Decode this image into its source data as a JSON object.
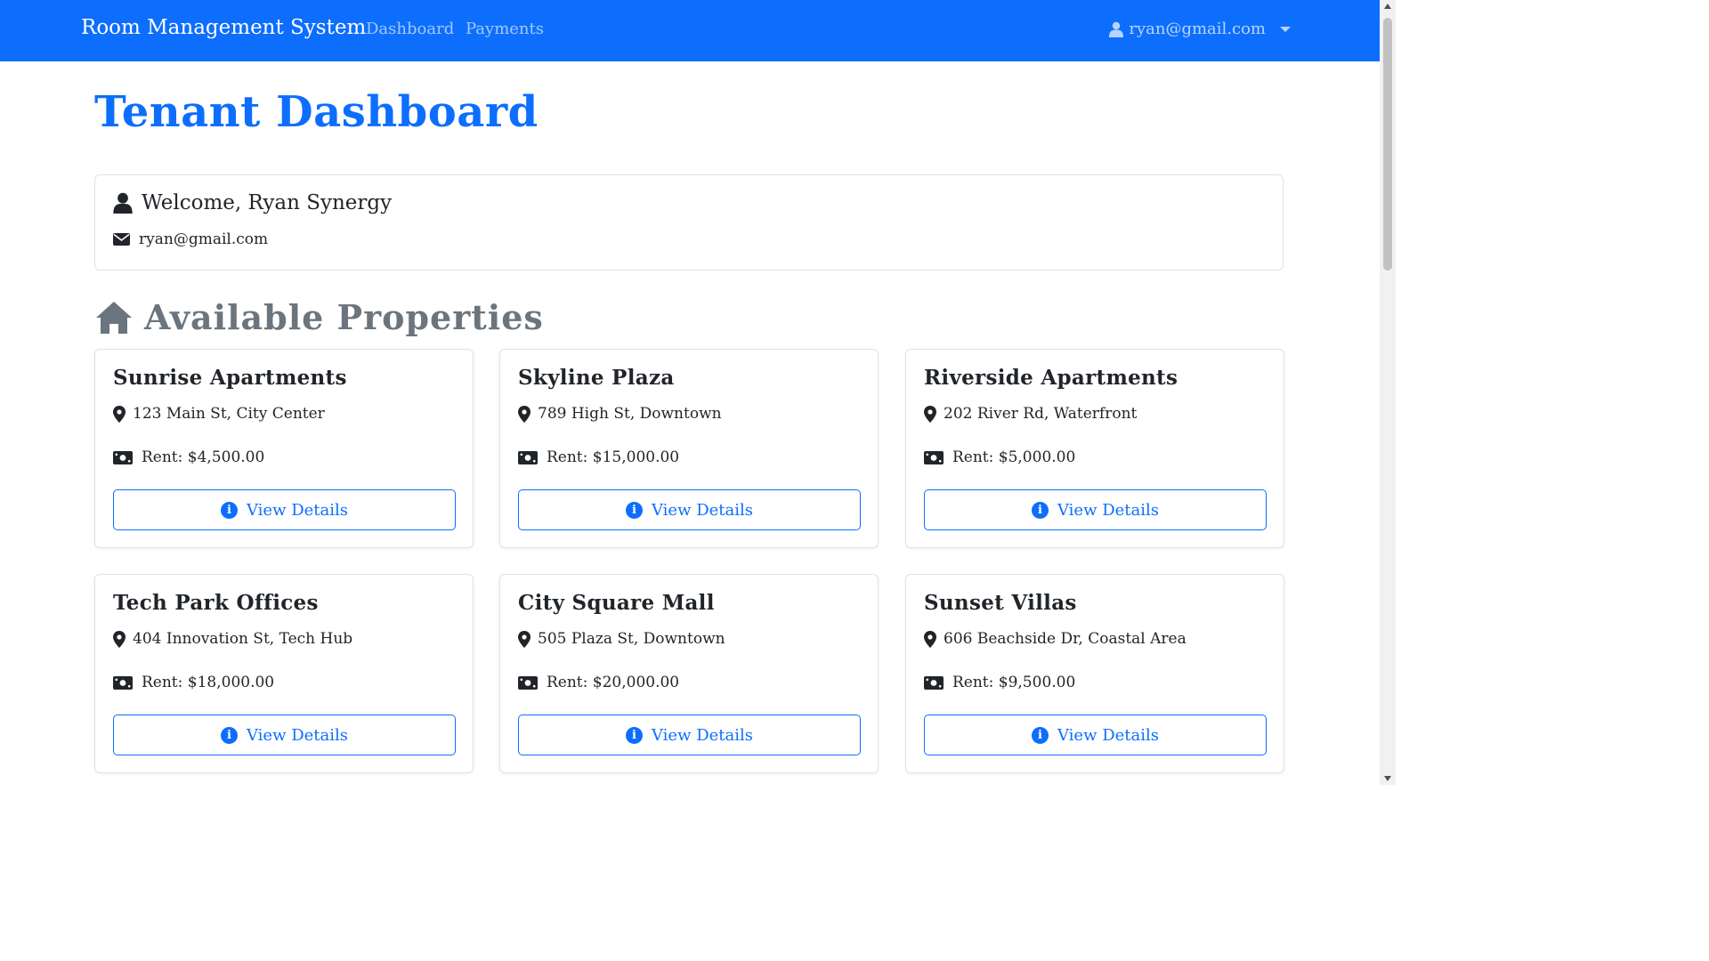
{
  "navbar": {
    "brand": "Room Management System",
    "links": [
      {
        "label": "Dashboard"
      },
      {
        "label": "Payments"
      }
    ],
    "user_email": "ryan@gmail.com"
  },
  "page": {
    "title": "Tenant Dashboard"
  },
  "welcome": {
    "greeting": "Welcome, Ryan Synergy",
    "email": "ryan@gmail.com"
  },
  "properties_section": {
    "title": "Available Properties",
    "button_label": "View Details",
    "items": [
      {
        "name": "Sunrise Apartments",
        "address": "123 Main St, City Center",
        "rent": "Rent: $4,500.00"
      },
      {
        "name": "Skyline Plaza",
        "address": "789 High St, Downtown",
        "rent": "Rent: $15,000.00"
      },
      {
        "name": "Riverside Apartments",
        "address": "202 River Rd, Waterfront",
        "rent": "Rent: $5,000.00"
      },
      {
        "name": "Tech Park Offices",
        "address": "404 Innovation St, Tech Hub",
        "rent": "Rent: $18,000.00"
      },
      {
        "name": "City Square Mall",
        "address": "505 Plaza St, Downtown",
        "rent": "Rent: $20,000.00"
      },
      {
        "name": "Sunset Villas",
        "address": "606 Beachside Dr, Coastal Area",
        "rent": "Rent: $9,500.00"
      }
    ]
  },
  "colors": {
    "primary": "#0d6efd",
    "muted": "#6c757d",
    "text": "#212529",
    "border": "#dee2e6"
  }
}
